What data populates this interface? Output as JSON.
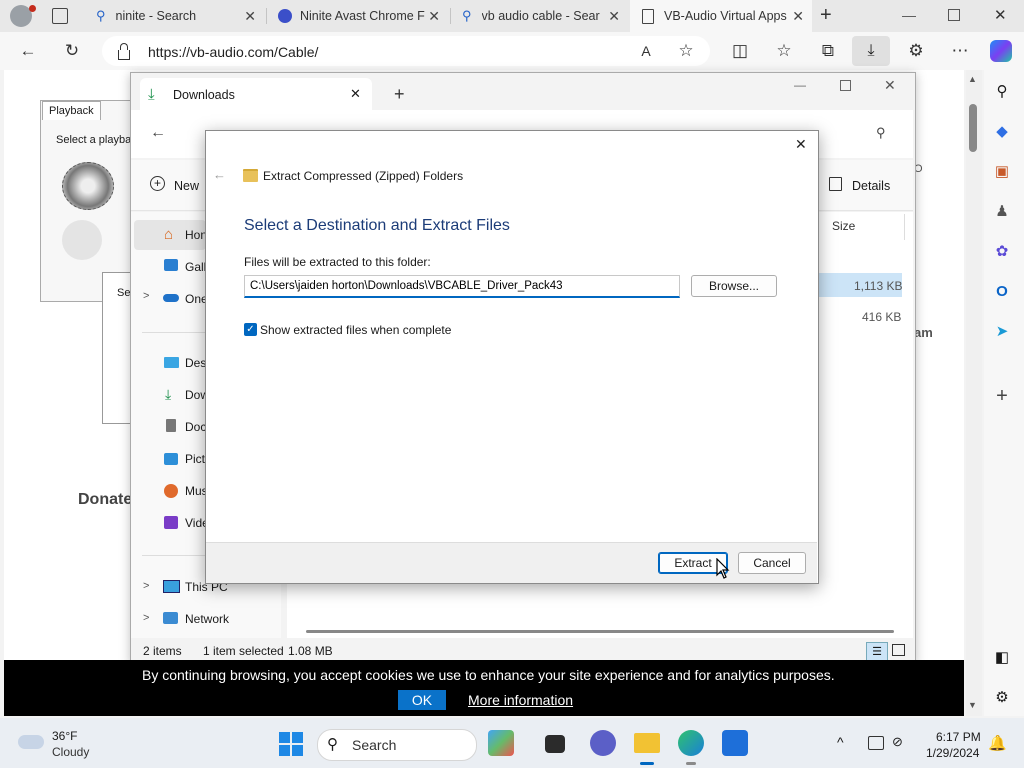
{
  "browser": {
    "tabs": [
      {
        "label": "ninite - Search",
        "icon": "search-icon"
      },
      {
        "label": "Ninite Avast Chrome F",
        "icon": "ninite-icon"
      },
      {
        "label": "vb audio cable - Searc",
        "icon": "search-icon"
      },
      {
        "label": "VB-Audio Virtual Apps",
        "icon": "page-icon"
      }
    ],
    "url": "https://vb-audio.com/Cable/",
    "accent": "#0067c0"
  },
  "webpage": {
    "playback_tab": "Playback",
    "select_text": "Select a playba",
    "se_text": "Se",
    "donate_text": "Donate",
    "am_text": "am",
    "o_text": "O"
  },
  "explorer": {
    "tab_title": "Downloads",
    "new_label": "New",
    "details_label": "Details",
    "size_header": "Size",
    "sizes": [
      "1,113 KB",
      "416 KB"
    ],
    "nav_items": [
      {
        "label": "Hon",
        "icon": "home-icon"
      },
      {
        "label": "Gall",
        "icon": "gallery-icon"
      },
      {
        "label": "One",
        "icon": "onedrive-icon"
      },
      {
        "label": "Desk",
        "icon": "desktop-icon"
      },
      {
        "label": "Dow",
        "icon": "download-icon"
      },
      {
        "label": "Doc",
        "icon": "documents-icon"
      },
      {
        "label": "Pict",
        "icon": "pictures-icon"
      },
      {
        "label": "Mus",
        "icon": "music-icon"
      },
      {
        "label": "Vide",
        "icon": "videos-icon"
      },
      {
        "label": "This PC",
        "icon": "pc-icon"
      },
      {
        "label": "Network",
        "icon": "network-icon"
      }
    ],
    "status": {
      "items": "2 items",
      "selected": "1 item selected",
      "size": "1.08 MB"
    }
  },
  "dialog": {
    "title": "Extract Compressed (Zipped) Folders",
    "heading": "Select a Destination and Extract Files",
    "path_label": "Files will be extracted to this folder:",
    "path_value": "C:\\Users\\jaiden horton\\Downloads\\VBCABLE_Driver_Pack43",
    "browse_label": "Browse...",
    "checkbox_label": "Show extracted files when complete",
    "checkbox_checked": true,
    "extract_label": "Extract",
    "cancel_label": "Cancel"
  },
  "cookie": {
    "text": "By continuing browsing, you accept cookies we use to enhance your site experience and for analytics purposes.",
    "ok_label": "OK",
    "more_label": "More information"
  },
  "taskbar": {
    "weather_temp": "36°F",
    "weather_desc": "Cloudy",
    "search_label": "Search",
    "time": "6:17 PM",
    "date": "1/29/2024"
  }
}
